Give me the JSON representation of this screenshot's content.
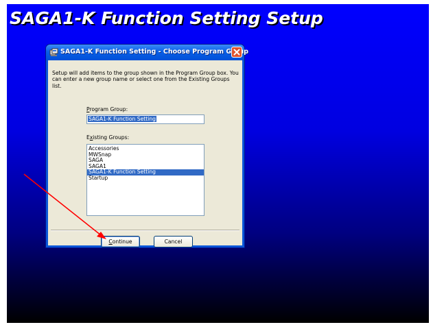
{
  "setup": {
    "title": "SAGA1-K Function Setting Setup"
  },
  "dialog": {
    "title": "SAGA1-K Function Setting - Choose Program Group",
    "intro_text": "Setup will add items to the group shown in the Program Group box. You can enter a new group name or select one from the Existing Groups list.",
    "program_group_label": "Program Group:",
    "program_group_value": "SAGA1-K Function Setting",
    "existing_groups_label": "Existing Groups:",
    "existing_groups": [
      "Accessories",
      "MWSnap",
      "SAGA",
      "SAGA1",
      "SAGA1-K Function Setting",
      "Startup"
    ],
    "selected_group": "SAGA1-K Function Setting",
    "continue_label": "Continue",
    "cancel_label": "Cancel"
  },
  "colors": {
    "desktop_gradient_top": "#0000ff",
    "desktop_gradient_bottom": "#000000",
    "titlebar": "#0a5fe6",
    "selection": "#316ac5",
    "annotation_arrow": "#ff0000"
  },
  "icons": {
    "app": "setup-app-icon",
    "close": "close-icon"
  }
}
